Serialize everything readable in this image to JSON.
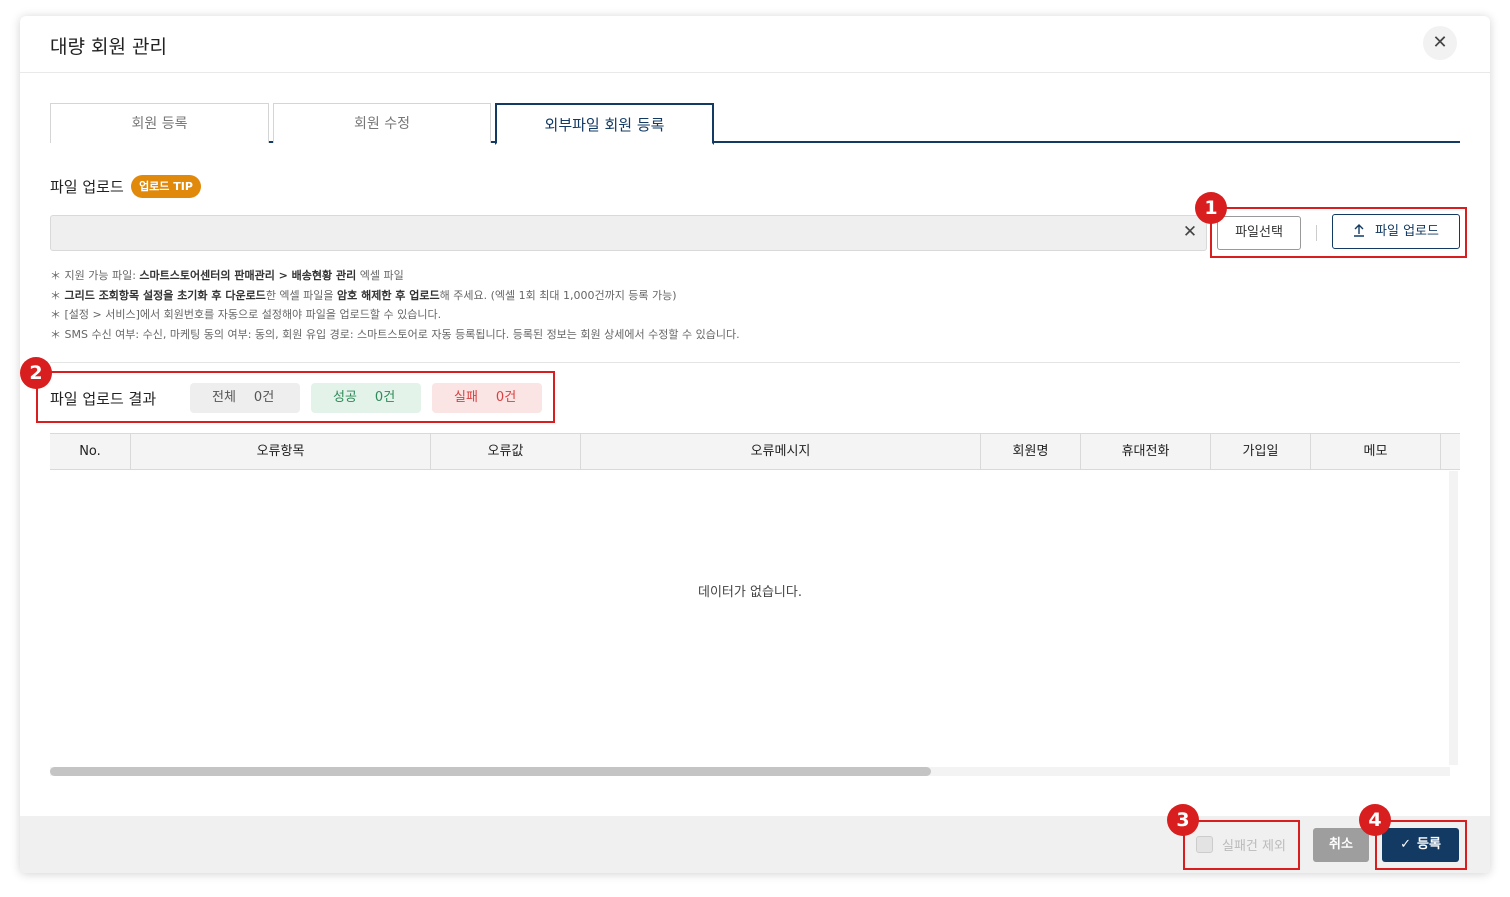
{
  "modal": {
    "title": "대량 회원 관리",
    "close_glyph": "✕"
  },
  "tabs": [
    {
      "label": "회원 등록"
    },
    {
      "label": "회원 수정"
    },
    {
      "label": "외부파일 회원 등록",
      "active": true
    }
  ],
  "upload": {
    "label": "파일 업로드",
    "tip_badge": "업로드 TIP",
    "input_value": "",
    "clear_glyph": "✕",
    "select_button": "파일선택",
    "upload_button": "파일 업로드"
  },
  "notes": {
    "line1_prefix": "＊ 지원 가능 파일: ",
    "line1_bold": "스마트스토어센터의 판매관리 > 배송현황 관리",
    "line1_suffix": " 엑셀 파일",
    "line2_prefix": "＊ ",
    "line2_bold1": "그리드 조회항목 설정을 초기화 후 다운로드",
    "line2_mid": "한 엑셀 파일을 ",
    "line2_bold2": "암호 해제한 후 업로드",
    "line2_suffix": "해 주세요. (엑셀 1회 최대 1,000건까지 등록 가능)",
    "line3": "＊ [설정 > 서비스]에서 회원번호를 자동으로 설정해야 파일을 업로드할 수 있습니다.",
    "line4": "＊ SMS 수신 여부: 수신, 마케팅 동의 여부: 동의, 회원 유입 경로: 스마트스토어로 자동 등록됩니다. 등록된 정보는 회원 상세에서 수정할 수 있습니다."
  },
  "results": {
    "label": "파일 업로드 결과",
    "total_label": "전체",
    "total_count": "0건",
    "success_label": "성공",
    "success_count": "0건",
    "fail_label": "실패",
    "fail_count": "0건"
  },
  "grid": {
    "columns": [
      "No.",
      "오류항목",
      "오류값",
      "오류메시지",
      "회원명",
      "휴대전화",
      "가입일",
      "메모"
    ],
    "empty_message": "데이터가 없습니다."
  },
  "footer": {
    "exclude_failed": "실패건 제외",
    "exclude_checked": false,
    "cancel": "취소",
    "register": "등록",
    "register_icon": "✓"
  },
  "annotations": [
    "1",
    "2",
    "3",
    "4"
  ],
  "colors": {
    "primary": "#123a63",
    "tip": "#e0890a",
    "success_text": "#2f8a57",
    "fail_text": "#d94141",
    "callout": "#d81e1e"
  }
}
